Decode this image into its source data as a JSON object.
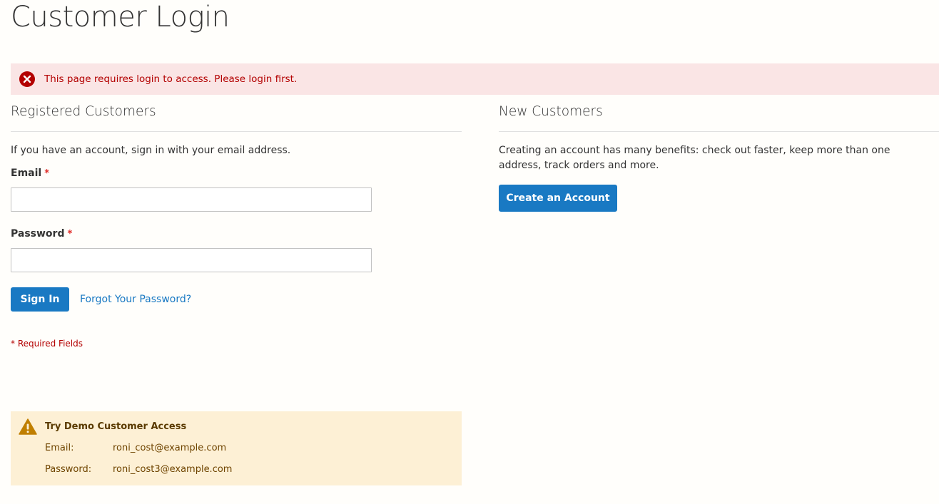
{
  "page": {
    "title": "Customer Login"
  },
  "error_message": {
    "text": "This page requires login to access. Please login first.",
    "icon": "error-circle-x-icon",
    "color": "#b30000",
    "background": "#fae5e5"
  },
  "registered": {
    "heading": "Registered Customers",
    "intro": "If you have an account, sign in with your email address.",
    "email_label": "Email",
    "email_value": "",
    "password_label": "Password",
    "password_value": "",
    "required_marker": "*",
    "sign_in_label": "Sign In",
    "forgot_label": "Forgot Your Password?",
    "required_note": "* Required Fields"
  },
  "new_customers": {
    "heading": "New Customers",
    "intro": "Creating an account has many benefits: check out faster, keep more than one address, track orders and more.",
    "create_label": "Create an Account"
  },
  "demo": {
    "icon": "warning-triangle-icon",
    "title": "Try Demo Customer Access",
    "email_key": "Email:",
    "email_value": "roni_cost@example.com",
    "password_key": "Password:",
    "password_value": "roni_cost3@example.com"
  },
  "colors": {
    "primary": "#1979c3",
    "error": "#b30000",
    "warning_bg": "#fdf0d5",
    "warning_icon": "#c07f00"
  }
}
